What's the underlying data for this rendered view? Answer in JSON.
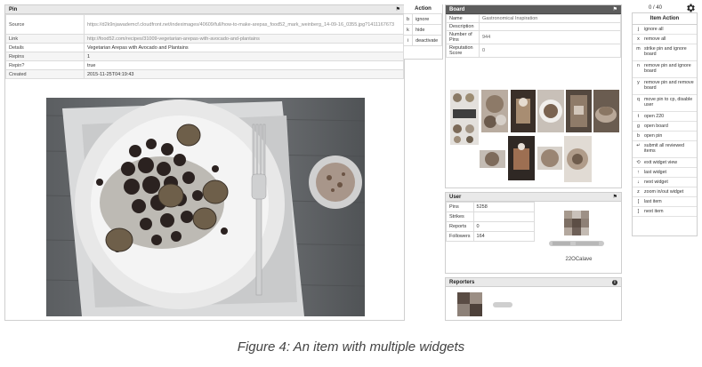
{
  "pin": {
    "title": "Pin",
    "rows": [
      {
        "key": "Source",
        "value": "https://d2k9njawademcf.cloudfront.net/indeximages/40609/full/how-to-make-arepas_food52_mark_weinberg_14-09-16_0355.jpg?1411167673"
      },
      {
        "key": "Link",
        "value": "http://food52.com/recipes/31009-vegetarian-arepas-with-avocado-and-plantains"
      },
      {
        "key": "Details",
        "value": "Vegetarian Arepas with Avocado and Plantains"
      },
      {
        "key": "Repins",
        "value": "1"
      },
      {
        "key": "Repin?",
        "value": "true"
      },
      {
        "key": "Created",
        "value": "2015-11-25T04:19:43"
      }
    ]
  },
  "action": {
    "title": "Action",
    "rows": [
      {
        "key": "b",
        "label": "ignore"
      },
      {
        "key": "k",
        "label": "hide"
      },
      {
        "key": "i",
        "label": "deactivate"
      }
    ]
  },
  "board": {
    "title": "Board",
    "rows": [
      {
        "key": "Name",
        "value": "Gastronomical Inspiration"
      },
      {
        "key": "Description",
        "value": ""
      },
      {
        "key": "Number of Pins",
        "value": "944"
      },
      {
        "key": "Reputation Score",
        "value": "0"
      }
    ]
  },
  "user": {
    "title": "User",
    "rows": [
      {
        "key": "Pins",
        "value": "5258"
      },
      {
        "key": "Strikes",
        "value": ""
      },
      {
        "key": "Reports",
        "value": "0"
      },
      {
        "key": "Followers",
        "value": "164"
      }
    ],
    "username": "22OCalave"
  },
  "reporters": {
    "title": "Reporters"
  },
  "items": {
    "counter": "0 / 40",
    "title": "Item Action",
    "rows": [
      {
        "key": "j",
        "label": "ignore all"
      },
      {
        "key": "x",
        "label": "remove all"
      },
      {
        "key": "m",
        "label": "strike pin and ignore board"
      },
      {
        "key": "n",
        "label": "remove pin and ignore board"
      },
      {
        "key": "y",
        "label": "remove pin and remove board"
      },
      {
        "key": "q",
        "label": "move pin to cp, disable user"
      },
      {
        "key": "t",
        "label": "open 220"
      },
      {
        "key": "g",
        "label": "open board"
      },
      {
        "key": "b",
        "label": "open pin"
      },
      {
        "key": "↵",
        "label": "submit all reviewed items"
      },
      {
        "key": "⟲",
        "label": "exit widget view"
      },
      {
        "key": "↑",
        "label": "last widget"
      },
      {
        "key": "↓",
        "label": "next widget"
      },
      {
        "key": "z",
        "label": "zoom in/out widget"
      },
      {
        "key": "[",
        "label": "last item"
      },
      {
        "key": "]",
        "label": "next item"
      }
    ]
  },
  "caption": "Figure 4: An item with multiple widgets"
}
